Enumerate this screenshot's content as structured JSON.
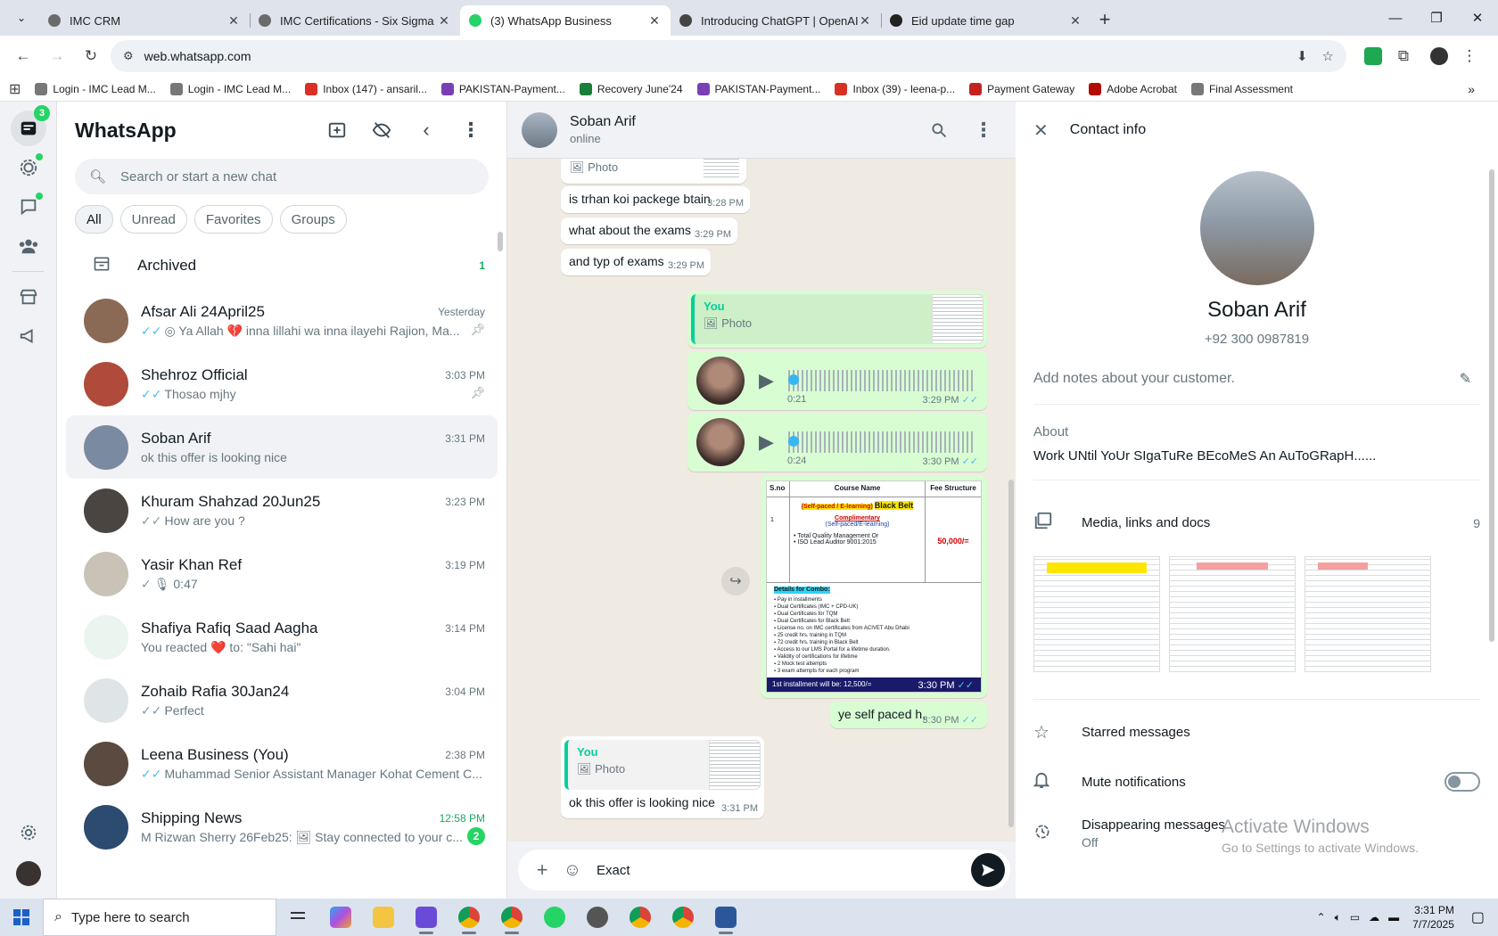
{
  "browser": {
    "tabs": [
      {
        "title": "IMC CRM",
        "color": "#6b6b6b",
        "active": false
      },
      {
        "title": "IMC Certifications - Six Sigma G",
        "color": "#6b6b6b",
        "active": false
      },
      {
        "title": "(3) WhatsApp Business",
        "color": "#25d366",
        "active": true
      },
      {
        "title": "Introducing ChatGPT | OpenAI",
        "color": "#444444",
        "active": false
      },
      {
        "title": "Eid update time gap",
        "color": "#222222",
        "active": false
      }
    ],
    "url": "web.whatsapp.com",
    "bookmarks": [
      {
        "label": "Login - IMC Lead M...",
        "color": "#777777"
      },
      {
        "label": "Login - IMC Lead M...",
        "color": "#777777"
      },
      {
        "label": "Inbox (147) - ansaril...",
        "color": "#d93025"
      },
      {
        "label": "PAKISTAN-Payment...",
        "color": "#7b3fb5"
      },
      {
        "label": "Recovery June'24",
        "color": "#188038"
      },
      {
        "label": "PAKISTAN-Payment...",
        "color": "#7b3fb5"
      },
      {
        "label": "Inbox (39) - leena-p...",
        "color": "#d93025"
      },
      {
        "label": "Payment Gateway",
        "color": "#c5221f"
      },
      {
        "label": "Adobe Acrobat",
        "color": "#b30b00"
      },
      {
        "label": "Final Assessment",
        "color": "#777777"
      }
    ]
  },
  "rail": {
    "chats_badge": "3"
  },
  "left": {
    "title": "WhatsApp",
    "search_placeholder": "Search or start a new chat",
    "filters": [
      "All",
      "Unread",
      "Favorites",
      "Groups"
    ],
    "archived_label": "Archived",
    "archived_count": "1",
    "chats": [
      {
        "name": "Afsar Ali 24April25",
        "time": "Yesterday",
        "tick": "✓✓",
        "tick_color": "blue",
        "preview": "◎ Ya Allah 💔 inna lillahi wa inna ilayehi Rajion, Ma...",
        "pinned": true,
        "unread": "",
        "avatar": "#8a6a55"
      },
      {
        "name": "Shehroz Official",
        "time": "3:03 PM",
        "tick": "✓✓",
        "tick_color": "blue",
        "preview": "Thosao mjhy",
        "pinned": true,
        "unread": "",
        "avatar": "#b04a3a"
      },
      {
        "name": "Soban Arif",
        "time": "3:31 PM",
        "tick": "",
        "tick_color": "",
        "preview": "ok this offer is looking nice",
        "pinned": false,
        "unread": "",
        "avatar": "#7a8aa0"
      },
      {
        "name": "Khuram Shahzad 20Jun25",
        "time": "3:23 PM",
        "tick": "✓✓",
        "tick_color": "gray",
        "preview": "How are you ?",
        "pinned": false,
        "unread": "",
        "avatar": "#4a4540"
      },
      {
        "name": "Yasir Khan Ref",
        "time": "3:19 PM",
        "tick": "✓",
        "tick_color": "gray",
        "preview": "🎙 0:47",
        "pinned": false,
        "unread": "",
        "avatar": "#c9c2b6"
      },
      {
        "name": "Shafiya Rafiq Saad Aagha",
        "time": "3:14 PM",
        "tick": "",
        "tick_color": "",
        "preview": "You reacted ❤️ to: \"Sahi hai\"",
        "pinned": false,
        "unread": "",
        "avatar": "#e9f5ee"
      },
      {
        "name": "Zohaib Rafia 30Jan24",
        "time": "3:04 PM",
        "tick": "✓✓",
        "tick_color": "gray",
        "preview": "Perfect",
        "pinned": false,
        "unread": "",
        "avatar": "#dfe5e7"
      },
      {
        "name": "Leena Business (You)",
        "time": "2:38 PM",
        "tick": "✓✓",
        "tick_color": "blue",
        "preview": "Muhammad Senior Assistant Manager Kohat Cement C...",
        "pinned": false,
        "unread": "",
        "avatar": "#5a4a40"
      },
      {
        "name": "Shipping News",
        "time": "12:58 PM",
        "tick": "",
        "tick_color": "",
        "preview": "M Rizwan Sherry 26Feb25: 🖼 Stay connected to your c...",
        "pinned": false,
        "unread": "2",
        "avatar": "#2d4a70"
      }
    ]
  },
  "conversation": {
    "name": "Soban Arif",
    "status": "online",
    "messages": {
      "photo_label": "Photo",
      "m1": {
        "text": "is trhan koi packege btain",
        "time": "3:28 PM"
      },
      "m2": {
        "text": "what about the exams",
        "time": "3:29 PM"
      },
      "m3": {
        "text": "and typ of exams",
        "time": "3:29 PM"
      },
      "q1": {
        "who": "You",
        "label": "Photo"
      },
      "v1": {
        "dur": "0:21",
        "time": "3:29 PM"
      },
      "v2": {
        "dur": "0:24",
        "time": "3:30 PM"
      },
      "img_time": "3:30 PM",
      "m4": {
        "text": "ye self paced h,",
        "time": "3:30 PM"
      },
      "q2": {
        "who": "You",
        "label": "Photo"
      },
      "m5": {
        "text": "ok this offer is looking nice",
        "time": "3:31 PM"
      }
    },
    "doc": {
      "headers": [
        "S.no",
        "Course Name",
        "Fee Structure"
      ],
      "sn": "1",
      "course_tag": "(Self-paced / E-learning)",
      "course_name": "Black Belt",
      "comp": "Complimentary",
      "comp_sub": "(Self-paced/E-learning)",
      "b1": "Total Quality Management Or",
      "b2": "ISO Lead Auditor 9001:2015",
      "fee": "50,000/=",
      "combo": "Details for Combo:",
      "items": [
        "Pay in installments",
        "Dual Certificates (IMC + CPD-UK)",
        "Dual Certificates for TQM",
        "Dual Certificates for Black Belt",
        "License no. on IMC certificates from ACIVET Abu Dhabi",
        "25 credit hrs. training in TQM",
        "72 credit hrs. training in Black Belt",
        "Access to our LMS Portal for a lifetime duration.",
        "Validity of certifications for lifetime",
        "2 Mock test attempts",
        "3 exam attempts for each program"
      ],
      "installment": "1st installment will be: 12,500/="
    },
    "composer_text": "Exact"
  },
  "info": {
    "title": "Contact info",
    "name": "Soban Arif",
    "phone": "+92 300 0987819",
    "notes_placeholder": "Add notes about your customer.",
    "about_label": "About",
    "about_text": "Work UNtil YoUr SIgaTuRe BEcoMeS An AuToGRapH......",
    "media_label": "Media, links and docs",
    "media_count": "9",
    "starred_label": "Starred messages",
    "mute_label": "Mute notifications",
    "disappearing_label": "Disappearing messages",
    "disappearing_value": "Off"
  },
  "watermark": {
    "line1": "Activate Windows",
    "line2": "Go to Settings to activate Windows."
  },
  "taskbar": {
    "search_placeholder": "Type here to search",
    "time": "3:31 PM",
    "date": "7/7/2025"
  }
}
